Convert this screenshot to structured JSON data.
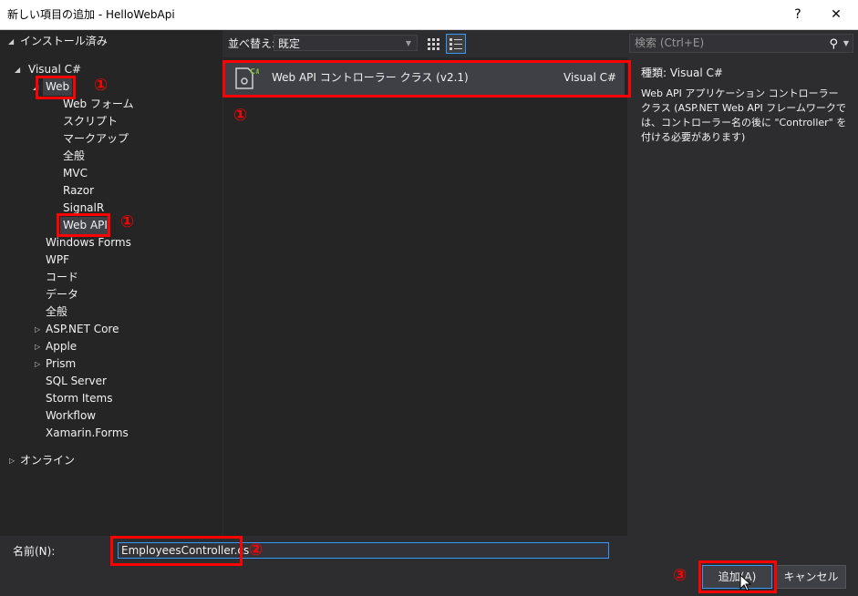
{
  "window": {
    "title": "新しい項目の追加 - HelloWebApi",
    "help_label": "?",
    "close_label": "✕"
  },
  "tree": {
    "installed": "インストール済み",
    "visual_csharp": "Visual C#",
    "items": {
      "web": "Web",
      "web_forms": "Web フォーム",
      "script": "スクリプト",
      "markup": "マークアップ",
      "general1": "全般",
      "mvc": "MVC",
      "razor": "Razor",
      "signalr": "SignalR",
      "webapi": "Web API",
      "windows_forms": "Windows Forms",
      "wpf": "WPF",
      "code": "コード",
      "data": "データ",
      "general2": "全般",
      "aspnet_core": "ASP.NET Core",
      "apple": "Apple",
      "prism": "Prism",
      "sql_server": "SQL Server",
      "storm_items": "Storm Items",
      "workflow": "Workflow",
      "xamarin_forms": "Xamarin.Forms"
    },
    "online": "オンライン"
  },
  "toolbar": {
    "sort_label": "並べ替え:",
    "sort_value": "既定"
  },
  "search": {
    "placeholder": "検索 (Ctrl+E)"
  },
  "templates": [
    {
      "name": "Web API コントローラー クラス (v2.1)",
      "language": "Visual C#"
    }
  ],
  "details": {
    "type_line": "種類:  Visual C#",
    "description": "Web API アプリケーション コントローラー クラス (ASP.NET Web API フレームワークでは、コントローラー名の後に \"Controller\" を付ける必要があります)"
  },
  "bottom": {
    "name_label": "名前(N):",
    "name_value": "EmployeesController.cs",
    "add_label": "追加(A)",
    "cancel_label": "キャンセル"
  },
  "annotations": {
    "step1": "①",
    "step2": "②",
    "step3": "③"
  },
  "colors": {
    "accent": "#3399ff",
    "annotation": "#ff0000",
    "background": "#2d2d30",
    "pane": "#252526"
  }
}
